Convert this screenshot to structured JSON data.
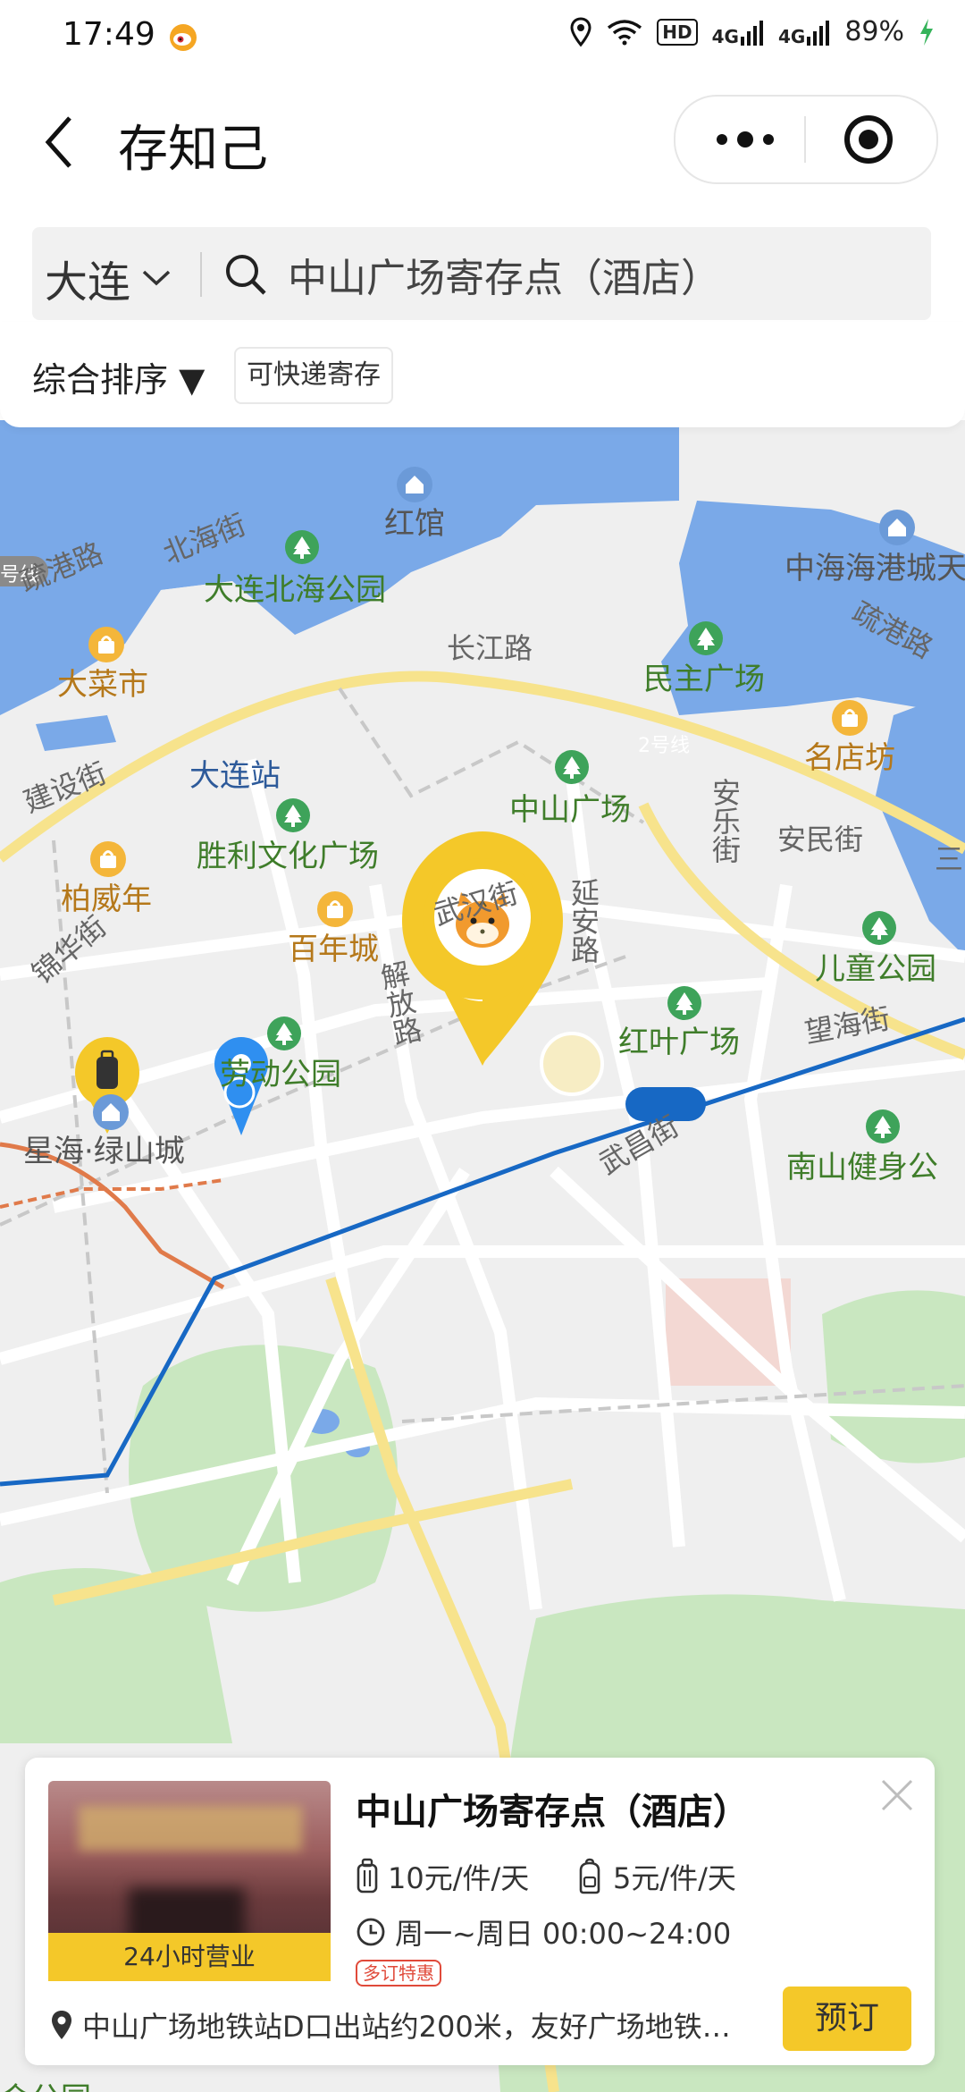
{
  "status_bar": {
    "time": "17:49",
    "hd": "HD",
    "net1": "4G",
    "net2": "4G",
    "battery": "89%"
  },
  "header": {
    "title": "存知己"
  },
  "search": {
    "city": "大连",
    "query": "中山广场寄存点（酒店）"
  },
  "filters": {
    "sort_label": "综合排序 ▼",
    "tag": "可快递寄存"
  },
  "map": {
    "labels": {
      "line_edge": "号线",
      "honguan": "红馆",
      "beihai_street": "北海街",
      "shugang_road_w": "疏港路",
      "beihai_park": "大连北海公园",
      "zhonghai": "中海海港城天",
      "shugang_road_e": "疏港路",
      "changjiang_road": "长江路",
      "minzhu_square": "民主广场",
      "dacai_market": "大菜市",
      "dalian_station": "大连站",
      "line2": "2号线",
      "mingdianfang": "名店坊",
      "jianshe_street": "建设街",
      "zhongshan_square": "中山广场",
      "anle_street": "安乐街",
      "anmin_street": "安民街",
      "san": "三",
      "shengli_square": "胜利文化广场",
      "baiweinian": "柏威年",
      "wuhan_street": "武汉街",
      "yanan_road": "延安路",
      "jinhua_street": "锦华街",
      "bainiancheng": "百年城",
      "ertong_park": "儿童公园",
      "jiefang_road": "解放路",
      "hongye_square": "红叶广场",
      "wanghai_street": "望海街",
      "laodong_park": "劳动公园",
      "xinghai": "星海·绿山城",
      "wuchang_street": "武昌街",
      "nanshan": "南山健身公",
      "corner": "会公园"
    }
  },
  "card": {
    "title": "中山广场寄存点（酒店）",
    "hours_badge": "24小时营业",
    "price_luggage": "10元/件/天",
    "price_backpack": "5元/件/天",
    "open_time": "周一~周日 00:00~24:00",
    "promo": "多订特惠",
    "address": "中山广场地铁站D口出站约200米，友好广场地铁…",
    "book_button": "预订"
  },
  "colors": {
    "accent": "#f4c829",
    "water": "#7aa9e8",
    "park": "#c9e7c0",
    "metro_line": "#1768c4"
  }
}
